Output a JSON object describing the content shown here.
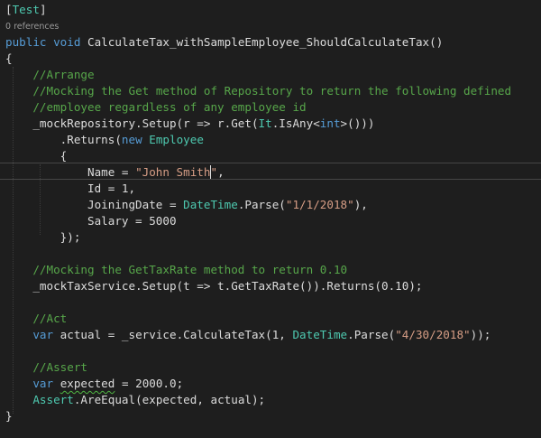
{
  "editor": {
    "codelens_references": "0 references",
    "lines": [
      [
        [
          "[",
          "#dcdcdc"
        ],
        [
          "Test",
          "#4ec9b0"
        ],
        [
          "]",
          "#dcdcdc"
        ]
      ],
      [
        [
          "public",
          "#569cd6"
        ],
        [
          " ",
          "#dcdcdc"
        ],
        [
          "void",
          "#569cd6"
        ],
        [
          " CalculateTax_withSampleEmployee_ShouldCalculateTax()",
          "#dcdcdc"
        ]
      ],
      [
        [
          "{",
          "#dcdcdc"
        ]
      ],
      [
        [
          "    ",
          "#dcdcdc"
        ],
        [
          "//Arrange",
          "#57a64a"
        ]
      ],
      [
        [
          "    ",
          "#dcdcdc"
        ],
        [
          "//Mocking the Get method of Repository to return the following defined",
          "#57a64a"
        ]
      ],
      [
        [
          "    ",
          "#dcdcdc"
        ],
        [
          "//employee regardless of any employee id",
          "#57a64a"
        ]
      ],
      [
        [
          "    _mockRepository.Setup(r => r.Get(",
          "#dcdcdc"
        ],
        [
          "It",
          "#4ec9b0"
        ],
        [
          ".IsAny<",
          "#dcdcdc"
        ],
        [
          "int",
          "#569cd6"
        ],
        [
          ">()))",
          "#dcdcdc"
        ]
      ],
      [
        [
          "        .Returns(",
          "#dcdcdc"
        ],
        [
          "new",
          "#569cd6"
        ],
        [
          " ",
          "#dcdcdc"
        ],
        [
          "Employee",
          "#4ec9b0"
        ]
      ],
      [
        [
          "        {",
          "#dcdcdc"
        ]
      ],
      [
        [
          "            Name = ",
          "#dcdcdc"
        ],
        [
          "\"John Smith",
          "#d69d85"
        ],
        [
          "|caret",
          "#dcdcdc"
        ],
        [
          "\"",
          "#d69d85"
        ],
        [
          ",",
          "#dcdcdc"
        ]
      ],
      [
        [
          "            Id = 1,",
          "#dcdcdc"
        ]
      ],
      [
        [
          "            JoiningDate = ",
          "#dcdcdc"
        ],
        [
          "DateTime",
          "#4ec9b0"
        ],
        [
          ".Parse(",
          "#dcdcdc"
        ],
        [
          "\"1/1/2018\"",
          "#d69d85"
        ],
        [
          "),",
          "#dcdcdc"
        ]
      ],
      [
        [
          "            Salary = 5000",
          "#dcdcdc"
        ]
      ],
      [
        [
          "        });",
          "#dcdcdc"
        ]
      ],
      [],
      [
        [
          "    ",
          "#dcdcdc"
        ],
        [
          "//Mocking the GetTaxRate method to return 0.10",
          "#57a64a"
        ]
      ],
      [
        [
          "    _mockTaxService.Setup(t => t.GetTaxRate()).Returns(0.10);",
          "#dcdcdc"
        ]
      ],
      [],
      [
        [
          "    ",
          "#dcdcdc"
        ],
        [
          "//Act",
          "#57a64a"
        ]
      ],
      [
        [
          "    ",
          "#dcdcdc"
        ],
        [
          "var",
          "#569cd6"
        ],
        [
          " actual = _service.CalculateTax(1, ",
          "#dcdcdc"
        ],
        [
          "DateTime",
          "#4ec9b0"
        ],
        [
          ".Parse(",
          "#dcdcdc"
        ],
        [
          "\"4/30/2018\"",
          "#d69d85"
        ],
        [
          "));",
          "#dcdcdc"
        ]
      ],
      [],
      [
        [
          "    ",
          "#dcdcdc"
        ],
        [
          "//Assert",
          "#57a64a"
        ]
      ],
      [
        [
          "    ",
          "#dcdcdc"
        ],
        [
          "var",
          "#569cd6"
        ],
        [
          " ",
          "#dcdcdc"
        ],
        [
          "expected",
          "#dcdcdc|squiggle"
        ],
        [
          " = 2000.0;",
          "#dcdcdc"
        ]
      ],
      [
        [
          "    ",
          "#dcdcdc"
        ],
        [
          "Assert",
          "#4ec9b0"
        ],
        [
          ".AreEqual(expected, actual);",
          "#dcdcdc"
        ]
      ],
      [
        [
          "}",
          "#dcdcdc"
        ]
      ]
    ]
  }
}
